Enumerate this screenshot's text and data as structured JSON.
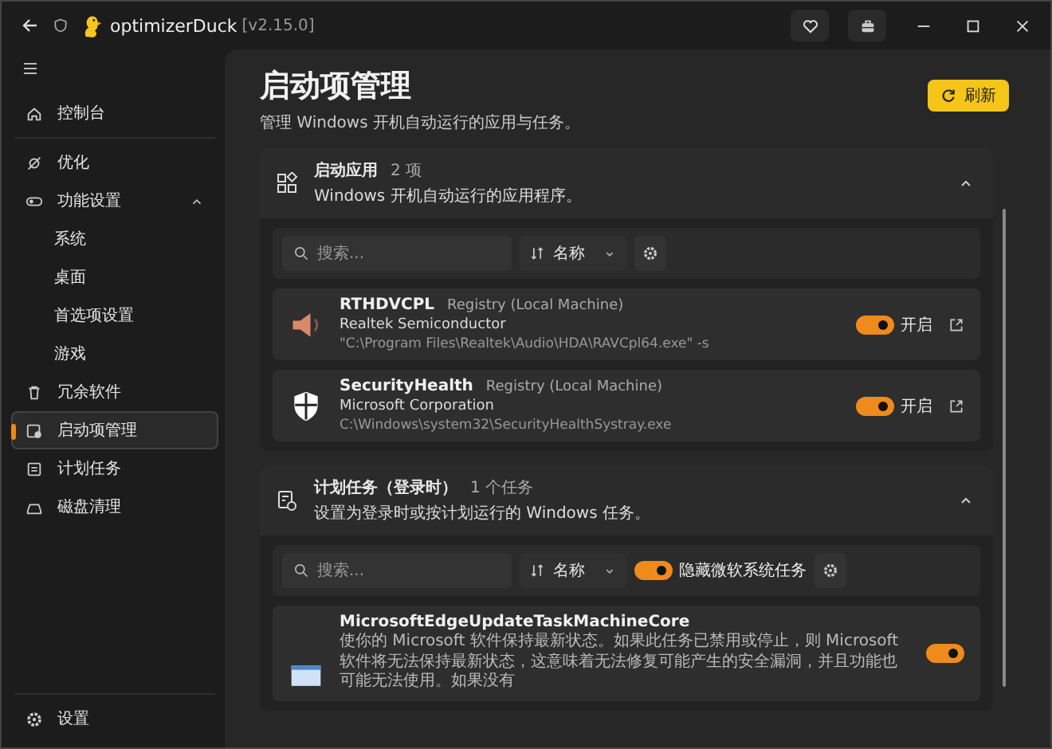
{
  "window": {
    "app_name": "optimizerDuck",
    "version": "[v2.15.0]"
  },
  "sidebar": {
    "items": [
      {
        "label": "控制台",
        "selected": false
      },
      {
        "label": "优化",
        "selected": false
      },
      {
        "label": "功能设置",
        "selected": false,
        "expanded": true,
        "children": [
          {
            "label": "系统",
            "selected": false
          },
          {
            "label": "桌面",
            "selected": false
          },
          {
            "label": "首选项设置",
            "selected": false
          },
          {
            "label": "游戏",
            "selected": false
          }
        ]
      },
      {
        "label": "冗余软件",
        "selected": false
      },
      {
        "label": "启动项管理",
        "selected": true
      },
      {
        "label": "计划任务",
        "selected": false
      },
      {
        "label": "磁盘清理",
        "selected": false
      }
    ],
    "footer": {
      "label": "设置",
      "selected": false
    }
  },
  "page": {
    "title": "启动项管理",
    "subtitle": "管理 Windows 开机自动运行的应用与任务。",
    "refresh_button": "刷新"
  },
  "sections": [
    {
      "title": "启动应用",
      "count": "2 项",
      "description": "Windows 开机自动运行的应用程序。",
      "expanded": true,
      "search_placeholder": "搜索...",
      "sort_label": "名称",
      "entries": [
        {
          "kind": "app",
          "name": "RTHDVCPL",
          "source": "Registry (Local Machine)",
          "publisher": "Realtek Semiconductor",
          "path": "\"C:\\Program Files\\Realtek\\Audio\\HDA\\RAVCpl64.exe\" -s",
          "on": true,
          "state_label": "开启"
        },
        {
          "kind": "app",
          "name": "SecurityHealth",
          "source": "Registry (Local Machine)",
          "publisher": "Microsoft Corporation",
          "path": "C:\\Windows\\system32\\SecurityHealthSystray.exe",
          "on": true,
          "state_label": "开启"
        }
      ]
    },
    {
      "title": "计划任务（登录时）",
      "count": "1 个任务",
      "description": "设置为登录时或按计划运行的 Windows 任务。",
      "expanded": true,
      "search_placeholder": "搜索...",
      "sort_label": "名称",
      "filter": {
        "label": "隐藏微软系统任务",
        "on": true
      },
      "entries": [
        {
          "kind": "task",
          "name": "MicrosoftEdgeUpdateTaskMachineCore",
          "description": "使你的 Microsoft 软件保持最新状态。如果此任务已禁用或停止，则 Microsoft 软件将无法保持最新状态，这意味着无法修复可能产生的安全漏洞，并且功能也可能无法使用。如果没有",
          "on": true
        }
      ]
    }
  ]
}
